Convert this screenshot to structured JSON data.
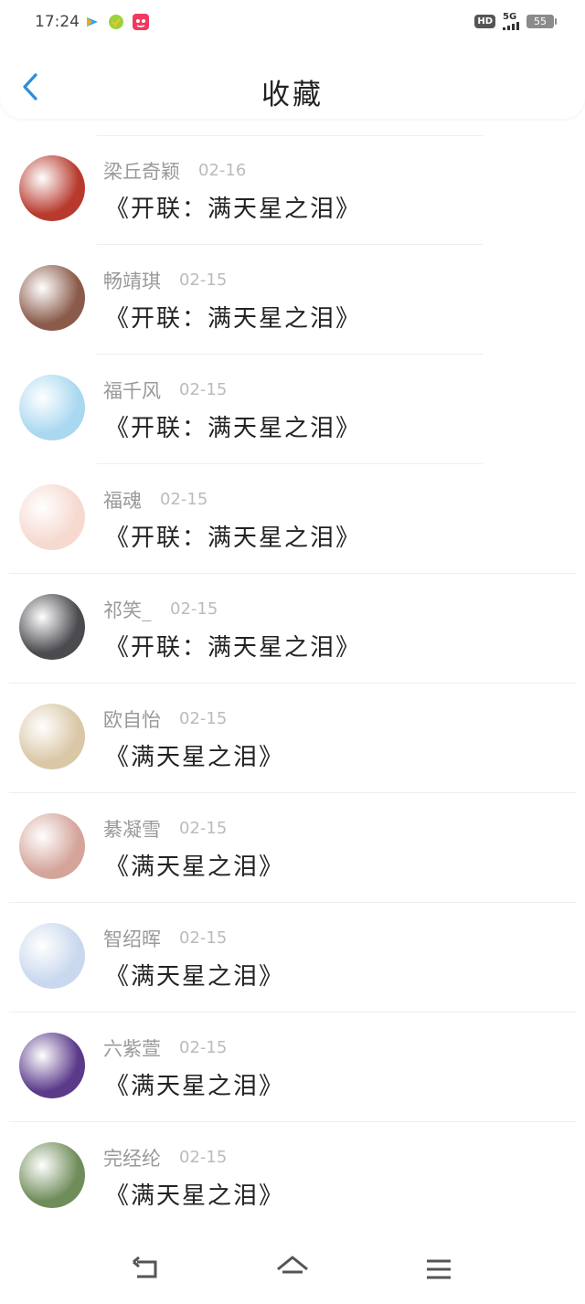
{
  "status_bar": {
    "time": "17:24",
    "hd_label": "HD",
    "network_label": "5G",
    "battery_level": "55",
    "app_icons": [
      "app-icon-1",
      "app-icon-2",
      "app-icon-3"
    ]
  },
  "header": {
    "title": "收藏",
    "back_icon": "chevron-left-icon"
  },
  "favorites": [
    {
      "name": "梁丘奇颖",
      "date": "02-16",
      "work": "《开联：满天星之泪》",
      "avatar_color": "#b83a2e"
    },
    {
      "name": "畅靖琪",
      "date": "02-15",
      "work": "《开联：满天星之泪》",
      "avatar_color": "#8a5a4a"
    },
    {
      "name": "福千风",
      "date": "02-15",
      "work": "《开联：满天星之泪》",
      "avatar_color": "#a9d8f0"
    },
    {
      "name": "福魂",
      "date": "02-15",
      "work": "《开联：满天星之泪》",
      "avatar_color": "#f6d9cf"
    },
    {
      "name": "祁笑_",
      "date": "02-15",
      "work": "《开联：满天星之泪》",
      "avatar_color": "#4a4a4f"
    },
    {
      "name": "欧自怡",
      "date": "02-15",
      "work": "《满天星之泪》",
      "avatar_color": "#d9c7a6"
    },
    {
      "name": "綦凝雪",
      "date": "02-15",
      "work": "《满天星之泪》",
      "avatar_color": "#d4a49a"
    },
    {
      "name": "智绍晖",
      "date": "02-15",
      "work": "《满天星之泪》",
      "avatar_color": "#c9d8ee"
    },
    {
      "name": "六紫萱",
      "date": "02-15",
      "work": "《满天星之泪》",
      "avatar_color": "#5b3a8a"
    },
    {
      "name": "完经纶",
      "date": "02-15",
      "work": "《满天星之泪》",
      "avatar_color": "#6f8c5a"
    }
  ],
  "nav_bar": {
    "back_icon": "return-icon",
    "home_icon": "home-icon",
    "menu_icon": "menu-icon"
  },
  "colors": {
    "accent": "#2a8ee0",
    "text_primary": "#222222",
    "text_secondary": "#999999",
    "divider": "#eeeeee"
  }
}
